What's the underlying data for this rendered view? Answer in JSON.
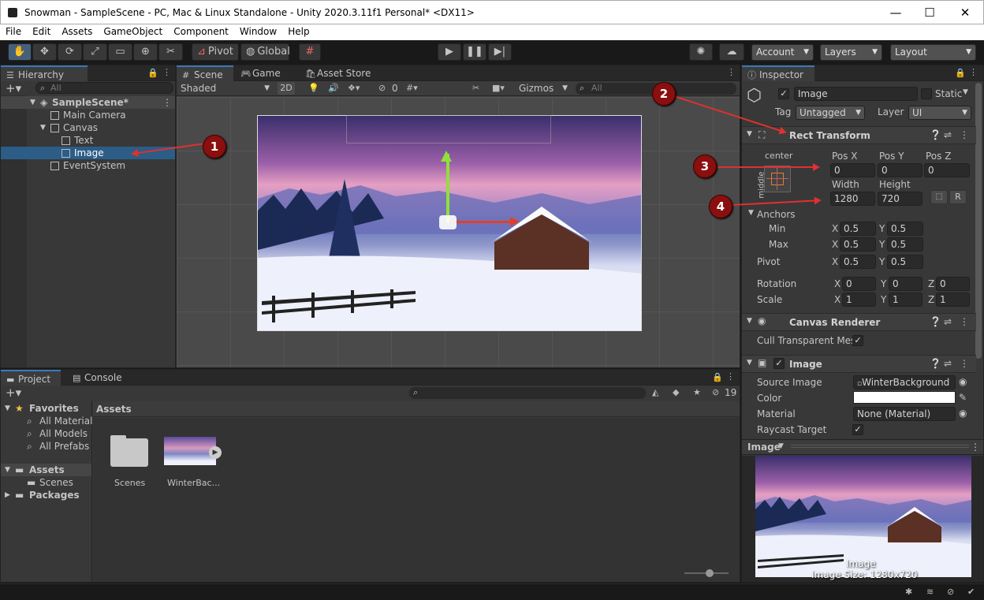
{
  "window": {
    "title": "Snowman - SampleScene - PC, Mac & Linux Standalone - Unity 2020.3.11f1 Personal* <DX11>",
    "minimize": "—",
    "maximize": "☐",
    "close": "✕"
  },
  "menu": [
    "File",
    "Edit",
    "Assets",
    "GameObject",
    "Component",
    "Window",
    "Help"
  ],
  "toolbar": {
    "pivot": "Pivot",
    "global": "Global",
    "account": "Account",
    "layers": "Layers",
    "layout": "Layout"
  },
  "hierarchy": {
    "tab": "Hierarchy",
    "search_placeholder": "All",
    "scene": "SampleScene*",
    "items": [
      "Main Camera",
      "Canvas",
      "Text",
      "Image",
      "EventSystem"
    ]
  },
  "scene": {
    "tabs": [
      "Scene",
      "Game",
      "Asset Store"
    ],
    "shading": "Shaded",
    "mode_2d": "2D",
    "hidden_count": "0",
    "gizmos": "Gizmos",
    "search_placeholder": "All"
  },
  "project": {
    "tabs": [
      "Project",
      "Console"
    ],
    "hidden_count": "19",
    "favorites_label": "Favorites",
    "favorites": [
      "All Materials",
      "All Models",
      "All Prefabs"
    ],
    "assets_label": "Assets",
    "assets_children": [
      "Scenes"
    ],
    "packages_label": "Packages",
    "breadcrumb": "Assets",
    "items": [
      "Scenes",
      "WinterBac..."
    ]
  },
  "inspector": {
    "tab": "Inspector",
    "object_name": "Image",
    "static_label": "Static",
    "tag_label": "Tag",
    "tag_value": "Untagged",
    "layer_label": "Layer",
    "layer_value": "UI",
    "rect_transform": {
      "title": "Rect Transform",
      "anchor_h": "center",
      "anchor_v": "middle",
      "pos_x_label": "Pos X",
      "pos_y_label": "Pos Y",
      "pos_z_label": "Pos Z",
      "pos_x": "0",
      "pos_y": "0",
      "pos_z": "0",
      "width_label": "Width",
      "height_label": "Height",
      "width": "1280",
      "height": "720",
      "r_button": "R",
      "anchors_label": "Anchors",
      "min_label": "Min",
      "max_label": "Max",
      "min_x": "0.5",
      "min_y": "0.5",
      "max_x": "0.5",
      "max_y": "0.5",
      "pivot_label": "Pivot",
      "pivot_x": "0.5",
      "pivot_y": "0.5",
      "rotation_label": "Rotation",
      "rot_x": "0",
      "rot_y": "0",
      "rot_z": "0",
      "scale_label": "Scale",
      "scale_x": "1",
      "scale_y": "1",
      "scale_z": "1",
      "x": "X",
      "y": "Y",
      "z": "Z"
    },
    "canvas_renderer": {
      "title": "Canvas Renderer",
      "cull_label": "Cull Transparent Mes"
    },
    "image": {
      "title": "Image",
      "source_label": "Source Image",
      "source_value": "WinterBackground",
      "color_label": "Color",
      "material_label": "Material",
      "material_value": "None (Material)",
      "raycast_label": "Raycast Target"
    },
    "preview": {
      "dropdown": "Image",
      "caption_1": "Image",
      "caption_2": "Image Size: 1280x720"
    }
  },
  "annotations": [
    "1",
    "2",
    "3",
    "4"
  ],
  "colors": {
    "accent": "#3a79bb",
    "selection": "#2c5d87",
    "annotation": "#8a0f0f",
    "arrow": "#e03030"
  }
}
